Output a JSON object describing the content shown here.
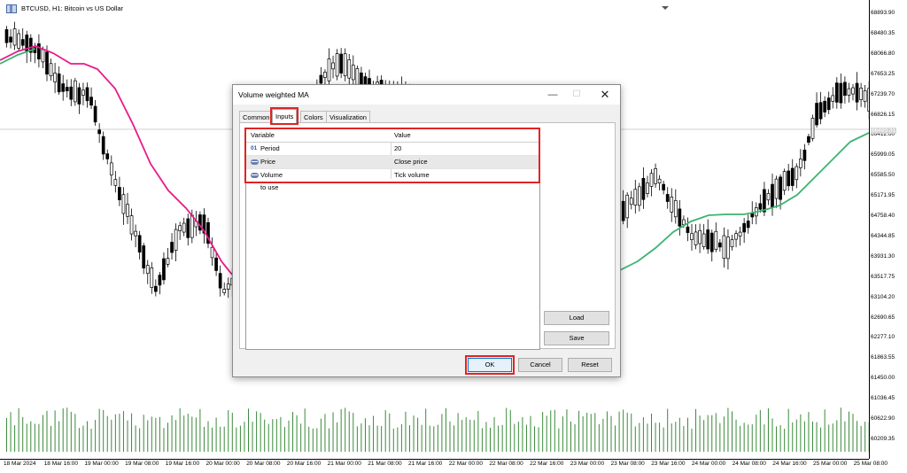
{
  "chart": {
    "symbol_title": "BTCUSD, H1:  Bitcoin vs US Dollar",
    "current_price": "66493.31",
    "price_labels": [
      "68893.90",
      "68480.35",
      "68066.80",
      "67653.25",
      "67239.70",
      "66826.15",
      "66412.60",
      "65999.05",
      "65585.50",
      "65171.95",
      "64758.40",
      "64344.85",
      "63931.30",
      "63517.75",
      "63104.20",
      "62690.65",
      "62277.10",
      "61863.55",
      "61450.00",
      "61036.45",
      "60622.90",
      "60209.35"
    ],
    "time_labels": [
      "18 Mar 2024",
      "18 Mar 16:00",
      "19 Mar 00:00",
      "19 Mar 08:00",
      "19 Mar 16:00",
      "20 Mar 00:00",
      "20 Mar 08:00",
      "20 Mar 16:00",
      "21 Mar 00:00",
      "21 Mar 08:00",
      "21 Mar 16:00",
      "22 Mar 00:00",
      "22 Mar 08:00",
      "22 Mar 16:00",
      "23 Mar 00:00",
      "23 Mar 08:00",
      "23 Mar 16:00",
      "24 Mar 00:00",
      "24 Mar 08:00",
      "24 Mar 16:00",
      "25 Mar 00:00",
      "25 Mar 08:00"
    ],
    "colors": {
      "ma_down": "#e8198b",
      "ma_up": "#3cb371",
      "volume": "#3a8a3a",
      "candle": "#000000"
    }
  },
  "dialog": {
    "title": "Volume weighted MA",
    "tabs": [
      "Common",
      "Inputs",
      "Colors",
      "Visualization"
    ],
    "active_tab": "Inputs",
    "table": {
      "headers": {
        "variable": "Variable",
        "value": "Value"
      },
      "rows": [
        {
          "icon": "01",
          "variable": "Period",
          "value": "20"
        },
        {
          "icon": "enum",
          "variable": "Price",
          "value": "Close price"
        },
        {
          "icon": "enum",
          "variable": "Volume to use",
          "value": "Tick volume"
        }
      ]
    },
    "side_buttons": {
      "load": "Load",
      "save": "Save"
    },
    "buttons": {
      "ok": "OK",
      "cancel": "Cancel",
      "reset": "Reset"
    }
  }
}
